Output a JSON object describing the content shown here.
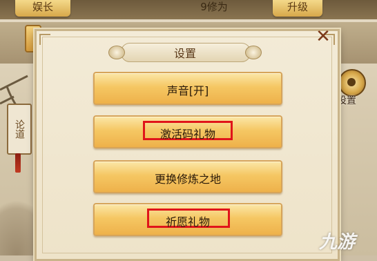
{
  "top_bar": {
    "left_tab": "娱长",
    "mid_text": "9修为",
    "right_tab": "升级"
  },
  "side": {
    "scroll_text": "论道",
    "gear_label": "设置"
  },
  "dialog": {
    "title": "设置",
    "close": "✕",
    "items": [
      {
        "label": "声音[开]",
        "highlighted": false
      },
      {
        "label": "激活码礼物",
        "highlighted": true
      },
      {
        "label": "更换修炼之地",
        "highlighted": false
      },
      {
        "label": "祈愿礼物",
        "highlighted": true
      }
    ]
  },
  "watermark": "九游",
  "colors": {
    "button_gold": "#f5c763",
    "highlight_red": "#e0141a"
  }
}
